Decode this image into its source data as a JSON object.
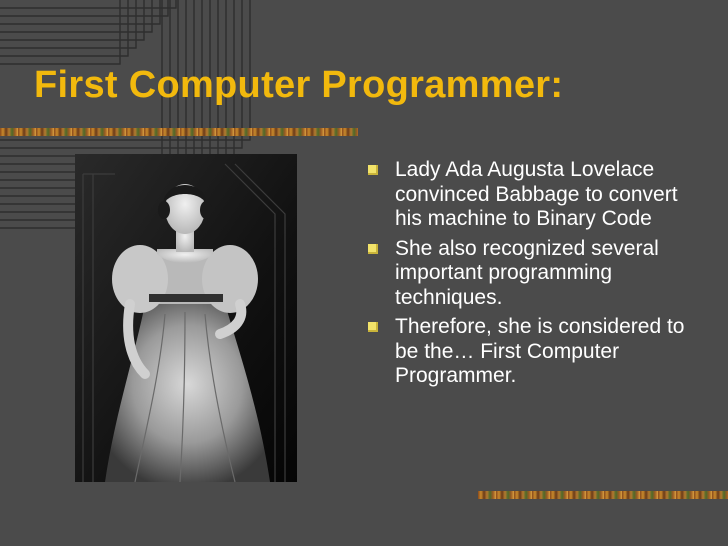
{
  "slide": {
    "title": "First Computer Programmer:",
    "bullets": [
      "Lady Ada Augusta Lovelace convinced Babbage to convert his machine to Binary Code",
      "She also recognized several important programming techniques.",
      "Therefore, she is considered to be the… First Computer Programmer."
    ]
  },
  "colors": {
    "background": "#4b4b4b",
    "title": "#f2b90d",
    "bullet_text": "#ffffff",
    "bullet_marker": "#f2e36a"
  },
  "icons": {
    "bullet": "square-bullet-icon"
  }
}
